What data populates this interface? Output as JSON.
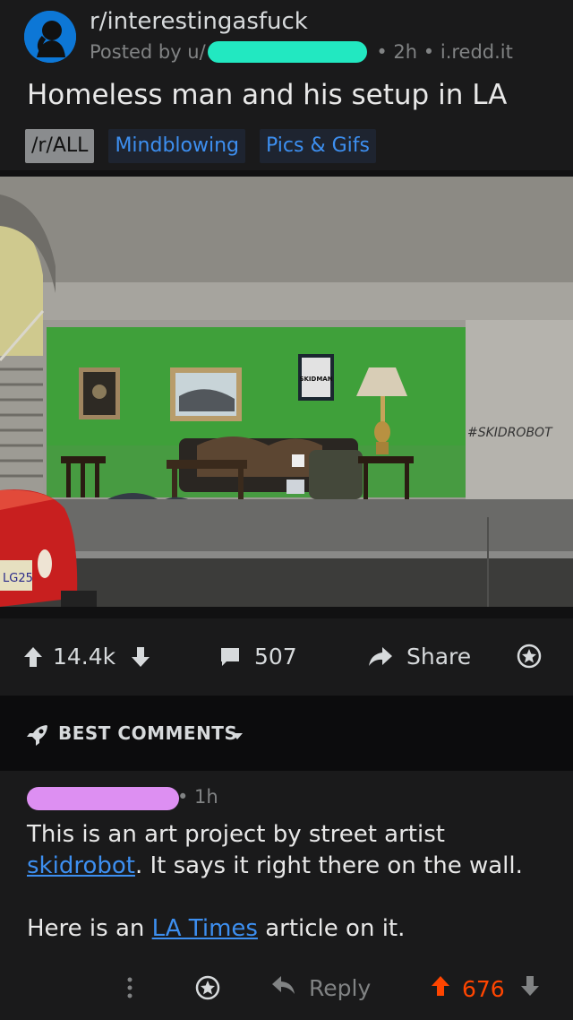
{
  "post": {
    "subreddit": "r/interestingasfuck",
    "posted_by_prefix": "Posted by u/",
    "age": "• 2h •",
    "domain": "i.redd.it",
    "title": "Homeless man and his setup in LA",
    "flairs": [
      "/r/ALL",
      "Mindblowing",
      "Pics & Gifs"
    ],
    "image": {
      "wall_tag": "#SKIDROBOT",
      "sign_text": "SKIDMAN",
      "plate_text": "LG25"
    }
  },
  "actions": {
    "score": "14.4k",
    "comments": "507",
    "share": "Share"
  },
  "sort": {
    "label": "BEST COMMENTS"
  },
  "comment": {
    "age": "• 1h",
    "line1_before": "This is an art project by street artist ",
    "line1_link": "skidrobot",
    "line1_after": ". It says it right there on the wall.",
    "line2_before": "Here is an ",
    "line2_link": "LA Times",
    "line2_after": " article on it.",
    "reply": "Reply",
    "score": "676"
  },
  "colors": {
    "upvote": "#ff4500",
    "link": "#3d8ff0",
    "user_redact": "#22e8c1",
    "commenter_redact": "#dd8ff2",
    "avatar": "#0d77d6"
  },
  "icons": [
    "upvote-icon",
    "downvote-icon",
    "comment-icon",
    "share-icon",
    "award-icon",
    "rocket-icon",
    "chevron-down-icon",
    "more-icon",
    "reply-icon"
  ]
}
